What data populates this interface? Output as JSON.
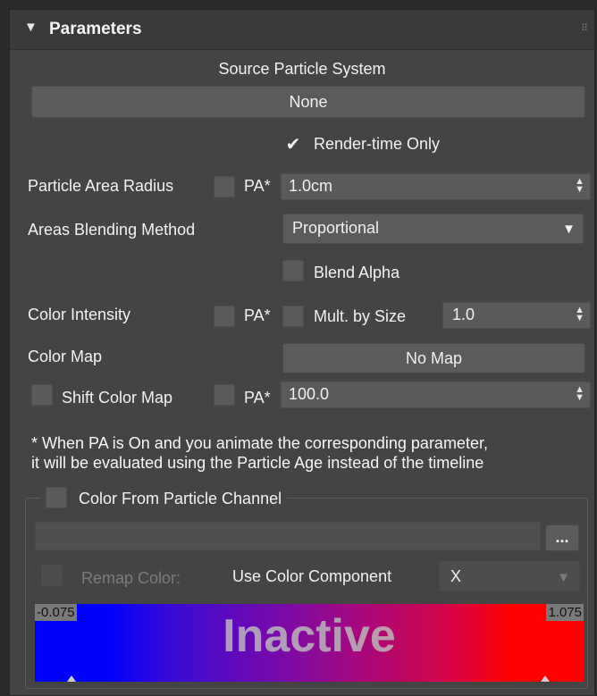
{
  "rollout": {
    "arrow": "▼",
    "title": "Parameters",
    "grip": "⠿"
  },
  "source": {
    "label": "Source Particle System",
    "button": "None"
  },
  "render_time_only": {
    "label": "Render-time Only",
    "checked": true,
    "check_glyph": "✔"
  },
  "particle_area_radius": {
    "label": "Particle Area Radius",
    "pa": "PA*",
    "value": "1.0cm"
  },
  "areas_blending": {
    "label": "Areas Blending Method",
    "value": "Proportional"
  },
  "blend_alpha": {
    "label": "Blend Alpha",
    "checked": false
  },
  "color_intensity": {
    "label": "Color Intensity",
    "pa": "PA*",
    "mult_label": "Mult. by Size",
    "value": "1.0"
  },
  "color_map": {
    "label": "Color Map",
    "button": "No Map"
  },
  "shift_color_map": {
    "label": "Shift Color Map",
    "pa": "PA*",
    "value": "100.0"
  },
  "note": {
    "line1": "* When PA is On and you animate the corresponding parameter,",
    "line2": "it will be evaluated using the Particle Age instead of the timeline"
  },
  "channel_group": {
    "label": "Color From Particle Channel",
    "browse": "...",
    "remap_label": "Remap Color:",
    "component_label": "Use Color Component",
    "component_value": "X",
    "gradient": {
      "min": "-0.075",
      "max": "1.075",
      "overlay": "Inactive",
      "left_color": "#0000ff",
      "right_color": "#ff0000"
    }
  },
  "glyphs": {
    "spin_up": "▲",
    "spin_down": "▼",
    "dropdown": "▼"
  }
}
